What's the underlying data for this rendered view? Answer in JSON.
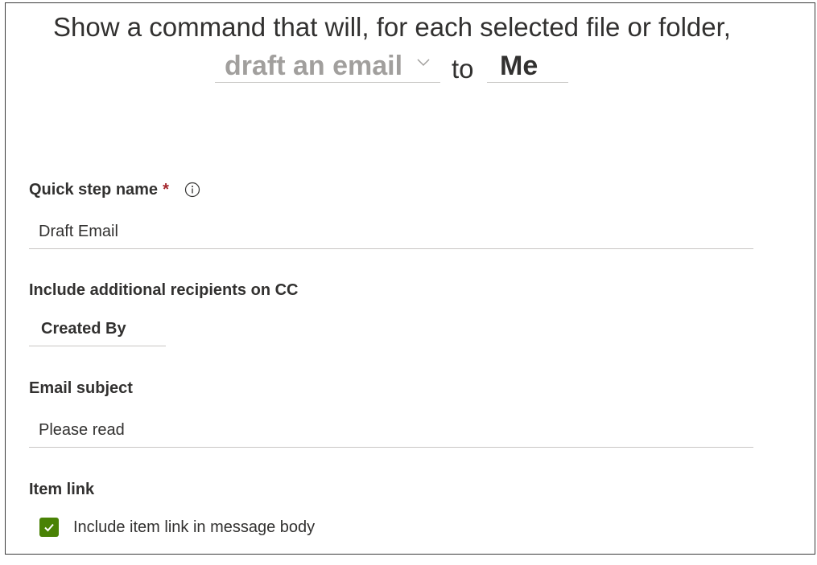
{
  "header": {
    "sentence_line1": "Show a command that will, for each selected file or folder,",
    "action_value": "draft an email",
    "to_word": "to",
    "recipient_value": "Me"
  },
  "form": {
    "quick_step_label": "Quick step name",
    "required_mark": "*",
    "quick_step_value": "Draft Email",
    "cc_label": "Include additional recipients on CC",
    "cc_value": "Created By",
    "subject_label": "Email subject",
    "subject_value": "Please read",
    "item_link_label": "Item link",
    "item_link_checkbox_label": "Include item link in message body",
    "item_link_checked": true
  },
  "colors": {
    "checkbox_fill": "#498205",
    "required": "#a4262c",
    "muted_text": "#a19f9d"
  }
}
